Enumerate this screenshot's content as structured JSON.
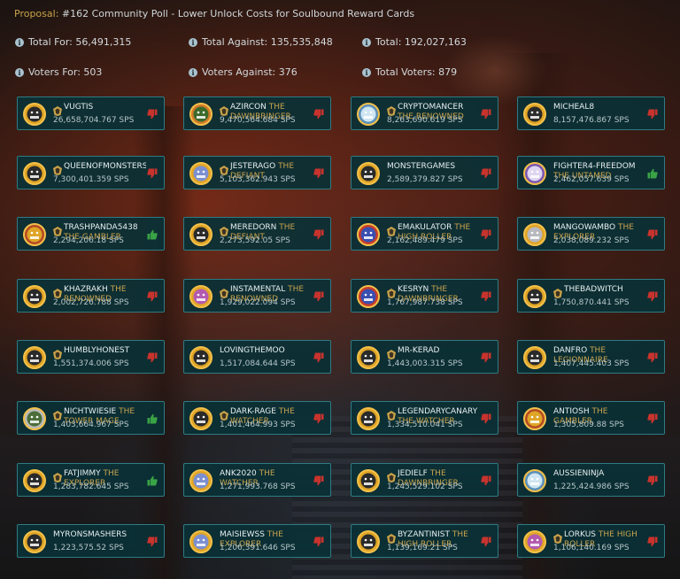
{
  "proposal": {
    "label": "Proposal:",
    "text": "#162 Community Poll - Lower Unlock Costs for Soulbound Reward Cards"
  },
  "stats": {
    "total_for": "Total For: 56,491,315",
    "total_against": "Total Against: 135,535,848",
    "total": "Total: 192,027,163",
    "voters_for": "Voters For: 503",
    "voters_against": "Voters Against: 376",
    "total_voters": "Total Voters: 879"
  },
  "colors": {
    "accent": "#c9a24a",
    "vote_for": "#3aa345",
    "vote_against": "#c8332d",
    "card_bg": "#0a3036",
    "card_border": "#2e7b83"
  },
  "voters": [
    {
      "name": "VUGTIS",
      "title": "",
      "sps": "26,658,704.767 SPS",
      "vote": "against",
      "avatar": "goblin-icon",
      "guild": "wings-emblem-icon"
    },
    {
      "name": "AZIRCON",
      "title": "THE DAWNBRINGER",
      "sps": "9,470,564.684 SPS",
      "vote": "against",
      "avatar": "dragon-icon",
      "guild": "leaf-emblem-icon"
    },
    {
      "name": "CRYPTOMANCER",
      "title": "THE RENOWNED",
      "sps": "8,263,690.619 SPS",
      "vote": "against",
      "avatar": "unicorn-icon",
      "guild": "crest-emblem-icon"
    },
    {
      "name": "MICHEAL8",
      "title": "",
      "sps": "8,157,476.867 SPS",
      "vote": "against",
      "avatar": "goblin-icon",
      "guild": ""
    },
    {
      "name": "QUEENOFMONSTERS",
      "title": "",
      "sps": "7,300,401.359 SPS",
      "vote": "against",
      "avatar": "goblin-icon",
      "guild": "gem-emblem-icon"
    },
    {
      "name": "JESTERAGO",
      "title": "THE DEFIANT",
      "sps": "5,103,362.943 SPS",
      "vote": "against",
      "avatar": "knight-icon",
      "guild": "star-emblem-icon"
    },
    {
      "name": "MONSTERGAMES",
      "title": "",
      "sps": "2,589,379.827 SPS",
      "vote": "against",
      "avatar": "goblin-icon",
      "guild": ""
    },
    {
      "name": "FIGHTER4-FREEDOM",
      "title": "THE UNTAMED",
      "sps": "2,462,057.639 SPS",
      "vote": "for",
      "avatar": "wizard-icon",
      "guild": ""
    },
    {
      "name": "TRASHPANDA5438",
      "title": "THE GAMBLER",
      "sps": "2,294,206.18 SPS",
      "vote": "for",
      "avatar": "beast-icon",
      "guild": "crest-emblem-icon"
    },
    {
      "name": "MEREDORN",
      "title": "THE DEFIANT",
      "sps": "2,273,592.05 SPS",
      "vote": "against",
      "avatar": "goblin-icon",
      "guild": "tower-emblem-icon"
    },
    {
      "name": "EMAKULATOR",
      "title": "THE HIGH ROLLER",
      "sps": "2,162,489.479 SPS",
      "vote": "against",
      "avatar": "warrior-icon",
      "guild": "crest-emblem-icon"
    },
    {
      "name": "MANGOWAMBO",
      "title": "THE EXPLORER",
      "sps": "2,038,089.232 SPS",
      "vote": "against",
      "avatar": "wolf-icon",
      "guild": ""
    },
    {
      "name": "KHAZRAKH",
      "title": "THE RENOWNED",
      "sps": "2,002,726.788 SPS",
      "vote": "against",
      "avatar": "goblin-icon",
      "guild": "cross-emblem-icon"
    },
    {
      "name": "INSTAMENTAL",
      "title": "THE RENOWNED",
      "sps": "1,929,022.094 SPS",
      "vote": "against",
      "avatar": "mage-icon",
      "guild": "shield-emblem-icon"
    },
    {
      "name": "KESRYN",
      "title": "THE DAWNBRINGER",
      "sps": "1,767,987.738 SPS",
      "vote": "against",
      "avatar": "warrior-icon",
      "guild": "crest-emblem-icon"
    },
    {
      "name": "THEBADWITCH",
      "title": "",
      "sps": "1,750,870.441 SPS",
      "vote": "against",
      "avatar": "goblin-icon",
      "guild": "shield-emblem-icon"
    },
    {
      "name": "HUMBLYHONEST",
      "title": "",
      "sps": "1,551,374.006 SPS",
      "vote": "against",
      "avatar": "goblin-icon",
      "guild": "gem-emblem-icon"
    },
    {
      "name": "LOVINGTHEMOO",
      "title": "",
      "sps": "1,517,084.644 SPS",
      "vote": "against",
      "avatar": "goblin-icon",
      "guild": ""
    },
    {
      "name": "MR-KERAD",
      "title": "",
      "sps": "1,443,003.315 SPS",
      "vote": "against",
      "avatar": "goblin-icon",
      "guild": "tower-emblem-icon"
    },
    {
      "name": "DANFRO",
      "title": "THE LEGIONNAIRE",
      "sps": "1,407,445.403 SPS",
      "vote": "against",
      "avatar": "goblin-icon",
      "guild": ""
    },
    {
      "name": "NICHTWIESIE",
      "title": "THE TOWER MAGE",
      "sps": "1,403,664.967 SPS",
      "vote": "for",
      "avatar": "elf-icon",
      "guild": "leaf-emblem-icon"
    },
    {
      "name": "DARK-RAGE",
      "title": "THE WATCHER",
      "sps": "1,401,464.993 SPS",
      "vote": "against",
      "avatar": "goblin-icon",
      "guild": "star-emblem-icon"
    },
    {
      "name": "LEGENDARYCANARY",
      "title": "THE WATCHER",
      "sps": "1,334,510.041 SPS",
      "vote": "against",
      "avatar": "goblin-icon",
      "guild": "leaf-emblem-icon"
    },
    {
      "name": "ANTIOSH",
      "title": "THE GAMBLER",
      "sps": "1,305,809.88 SPS",
      "vote": "against",
      "avatar": "beast-icon",
      "guild": ""
    },
    {
      "name": "FATJIMMY",
      "title": "THE EXPLORER",
      "sps": "1,283,782.645 SPS",
      "vote": "for",
      "avatar": "goblin-icon",
      "guild": "crest-emblem-icon"
    },
    {
      "name": "ANK2020",
      "title": "THE WATCHER",
      "sps": "1,271,993.768 SPS",
      "vote": "against",
      "avatar": "knight-icon",
      "guild": ""
    },
    {
      "name": "JEDIELF",
      "title": "THE DAWNBRINGER",
      "sps": "1,245,529.102 SPS",
      "vote": "against",
      "avatar": "goblin-icon",
      "guild": "crest-emblem-icon"
    },
    {
      "name": "AUSSIENINJA",
      "title": "",
      "sps": "1,225,424.986 SPS",
      "vote": "against",
      "avatar": "unicorn-icon",
      "guild": ""
    },
    {
      "name": "MYRONSMASHERS",
      "title": "",
      "sps": "1,223,575.52 SPS",
      "vote": "against",
      "avatar": "goblin-icon",
      "guild": ""
    },
    {
      "name": "MAISIEWSS",
      "title": "THE EXPLORER",
      "sps": "1,206,391.646 SPS",
      "vote": "against",
      "avatar": "knight-icon",
      "guild": ""
    },
    {
      "name": "BYZANTINIST",
      "title": "THE HIGH ROLLER",
      "sps": "1,139,169.21 SPS",
      "vote": "against",
      "avatar": "goblin-icon",
      "guild": "cross-emblem-icon"
    },
    {
      "name": "LORKUS",
      "title": "THE HIGH ROLLER",
      "sps": "1,106,140.169 SPS",
      "vote": "against",
      "avatar": "mage-icon",
      "guild": "shield-emblem-icon"
    }
  ]
}
